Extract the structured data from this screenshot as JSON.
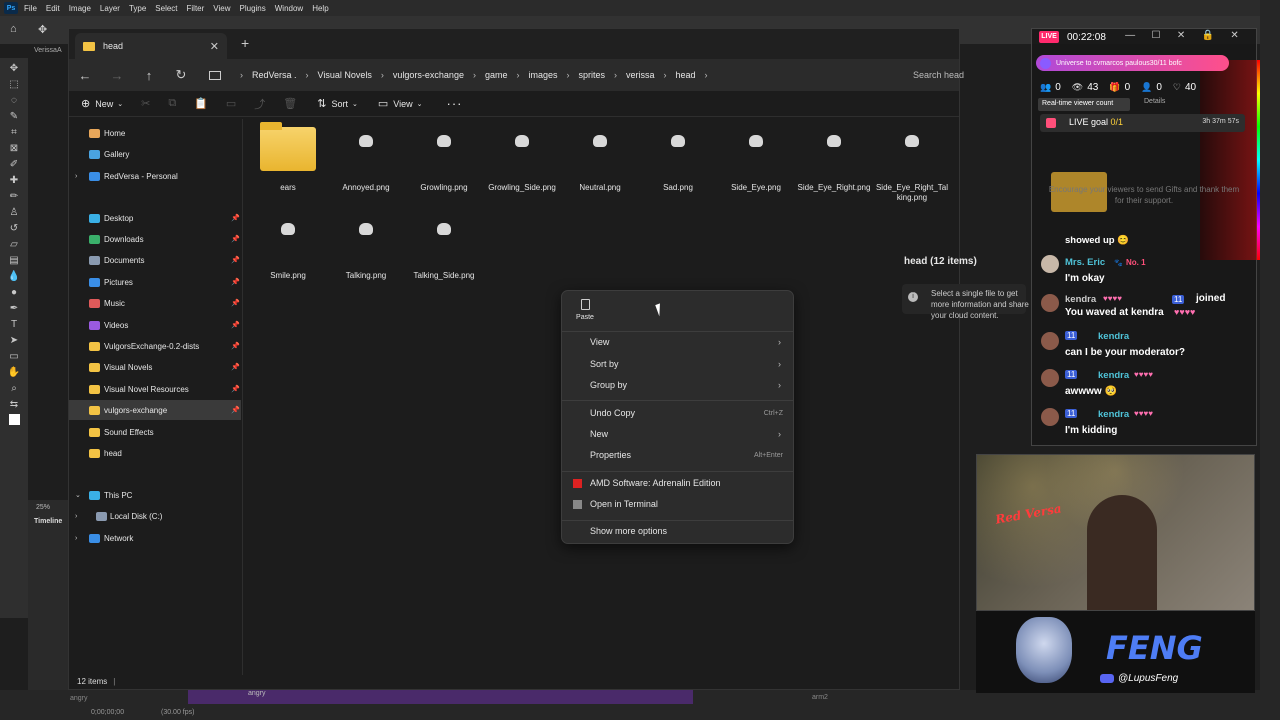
{
  "photoshop": {
    "logo": "Ps",
    "menu": [
      "File",
      "Edit",
      "Image",
      "Layer",
      "Type",
      "Select",
      "Filter",
      "View",
      "Plugins",
      "Window",
      "Help"
    ],
    "doc_tab": "VerissaA",
    "zoom": "25%",
    "timeline_label": "Timeline",
    "timeline_time": "0;00;00;00",
    "timeline_fps": "(30.00 fps)",
    "clip_left": "angry",
    "clip_mid": "angry",
    "clip_right": "arm2"
  },
  "explorer": {
    "tab_title": "head",
    "search_placeholder": "Search head",
    "breadcrumbs": [
      "RedVersa .",
      "Visual Novels",
      "vulgors-exchange",
      "game",
      "images",
      "sprites",
      "verissa",
      "head"
    ],
    "commands": {
      "new": "New",
      "sort": "Sort",
      "view": "View"
    },
    "nav": [
      {
        "label": "Home",
        "icon": "home-icon",
        "color": "#e8a75a"
      },
      {
        "label": "Gallery",
        "icon": "gallery-icon",
        "color": "#4aa3e0"
      },
      {
        "label": "RedVersa - Personal",
        "icon": "onedrive-icon",
        "color": "#3a8ee6"
      },
      {
        "label": "Desktop",
        "icon": "desktop-icon",
        "color": "#3ab0e6"
      },
      {
        "label": "Downloads",
        "icon": "downloads-icon",
        "color": "#3ab06a"
      },
      {
        "label": "Documents",
        "icon": "documents-icon",
        "color": "#8a9ab0"
      },
      {
        "label": "Pictures",
        "icon": "pictures-icon",
        "color": "#3a8ee6"
      },
      {
        "label": "Music",
        "icon": "music-icon",
        "color": "#e05a5a"
      },
      {
        "label": "Videos",
        "icon": "videos-icon",
        "color": "#9a5ae0"
      },
      {
        "label": "VulgorsExchange-0.2-dists",
        "icon": "folder-icon",
        "color": "#f3c344"
      },
      {
        "label": "Visual Novels",
        "icon": "folder-icon",
        "color": "#f3c344"
      },
      {
        "label": "Visual Novel Resources",
        "icon": "folder-icon",
        "color": "#f3c344"
      },
      {
        "label": "vulgors-exchange",
        "icon": "folder-icon",
        "color": "#f3c344"
      },
      {
        "label": "Sound Effects",
        "icon": "folder-icon",
        "color": "#f3c344"
      },
      {
        "label": "head",
        "icon": "folder-icon",
        "color": "#f3c344"
      },
      {
        "label": "This PC",
        "icon": "this-pc-icon",
        "color": "#3ab0e6"
      },
      {
        "label": "Local Disk (C:)",
        "icon": "disk-icon",
        "color": "#8a9ab0"
      },
      {
        "label": "Network",
        "icon": "network-icon",
        "color": "#3a8ee6"
      }
    ],
    "files": [
      "ears",
      "Annoyed.png",
      "Growling.png",
      "Growling_Side.png",
      "Neutral.png",
      "Sad.png",
      "Side_Eye.png",
      "Side_Eye_Right.png",
      "Side_Eye_Right_Talking.png",
      "Smile.png",
      "Talking.png",
      "Talking_Side.png"
    ],
    "status": "12 items",
    "details_title": "head (12 items)",
    "details_text": "Select a single file to get more information and share your cloud content."
  },
  "context_menu": {
    "paste": "Paste",
    "items": [
      {
        "label": "View",
        "shortcut": "",
        "submenu": true
      },
      {
        "label": "Sort by",
        "shortcut": "",
        "submenu": true
      },
      {
        "label": "Group by",
        "shortcut": "",
        "submenu": true
      },
      {
        "label": "Undo Copy",
        "shortcut": "Ctrl+Z",
        "submenu": false
      },
      {
        "label": "New",
        "shortcut": "",
        "submenu": true
      },
      {
        "label": "Properties",
        "shortcut": "Alt+Enter",
        "submenu": false
      },
      {
        "label": "AMD Software: Adrenalin Edition",
        "shortcut": "",
        "submenu": false
      },
      {
        "label": "Open in Terminal",
        "shortcut": "",
        "submenu": false
      },
      {
        "label": "Show more options",
        "shortcut": "",
        "submenu": false
      }
    ]
  },
  "overlay": {
    "live": "LIVE",
    "timer": "00:22:08",
    "gift_banner": "Universe to cvmarcos paulous30/11 bofc",
    "stats": {
      "viewers": "0",
      "views": "43",
      "gifts": "0",
      "followers": "0",
      "likes": "40"
    },
    "tooltip": "Real-time viewer count",
    "details": "Details",
    "goal_label": "LIVE goal",
    "goal_value": "0/1",
    "goal_time": "3h 37m 57s",
    "encourage": "Encourage your viewers to send Gifts and thank them for their support.",
    "chat": [
      {
        "name": "",
        "msg": "showed up"
      },
      {
        "name": "Mrs. Eric",
        "badge": "No. 1",
        "msg": "I'm okay"
      },
      {
        "name": "kendra",
        "level": "11",
        "msg": "joined"
      },
      {
        "name": "",
        "msg": "You waved at kendra"
      },
      {
        "name": "kendra",
        "level": "11",
        "msg": "can I be your moderator?"
      },
      {
        "name": "kendra",
        "level": "11",
        "msg": "awwww"
      },
      {
        "name": "kendra",
        "level": "11",
        "msg": "I'm kidding"
      }
    ],
    "webcam_sign": "Red Versa",
    "brand_name": "FENG",
    "discord": "@LupusFeng"
  },
  "colors": {
    "accent_live": "#ff2a6d",
    "folder": "#f3c344",
    "link_blue": "#4e7df5"
  }
}
